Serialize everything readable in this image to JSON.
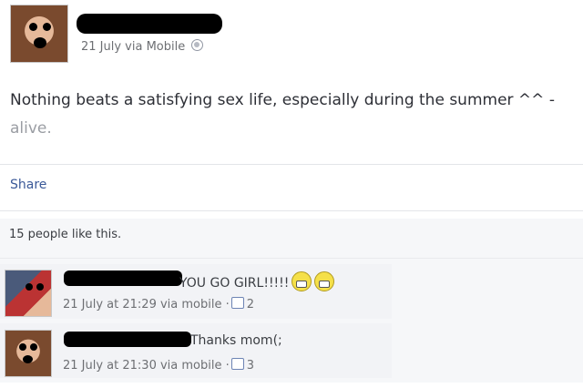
{
  "post": {
    "meta": "21 July via Mobile",
    "audience_icon": "globe-icon",
    "text_line1": "Nothing beats a satisfying sex life, especially during the summer ^^ -",
    "text_line2": "alive."
  },
  "actions": {
    "share_label": "Share"
  },
  "likes_summary": "15 people like this.",
  "comments": [
    {
      "text": "YOU GO GIRL!!!!!",
      "emoji_icon": "grin-emoji-icon",
      "meta": "21 July at 21:29 via mobile",
      "separator": "·",
      "like_count": "2"
    },
    {
      "text": "Thanks mom(;",
      "meta": "21 July at 21:30 via mobile",
      "separator": "·",
      "like_count": "3"
    }
  ],
  "colors": {
    "link": "#3b5998",
    "meta": "#6d6f73",
    "ufi_bg": "#f6f7f9"
  }
}
